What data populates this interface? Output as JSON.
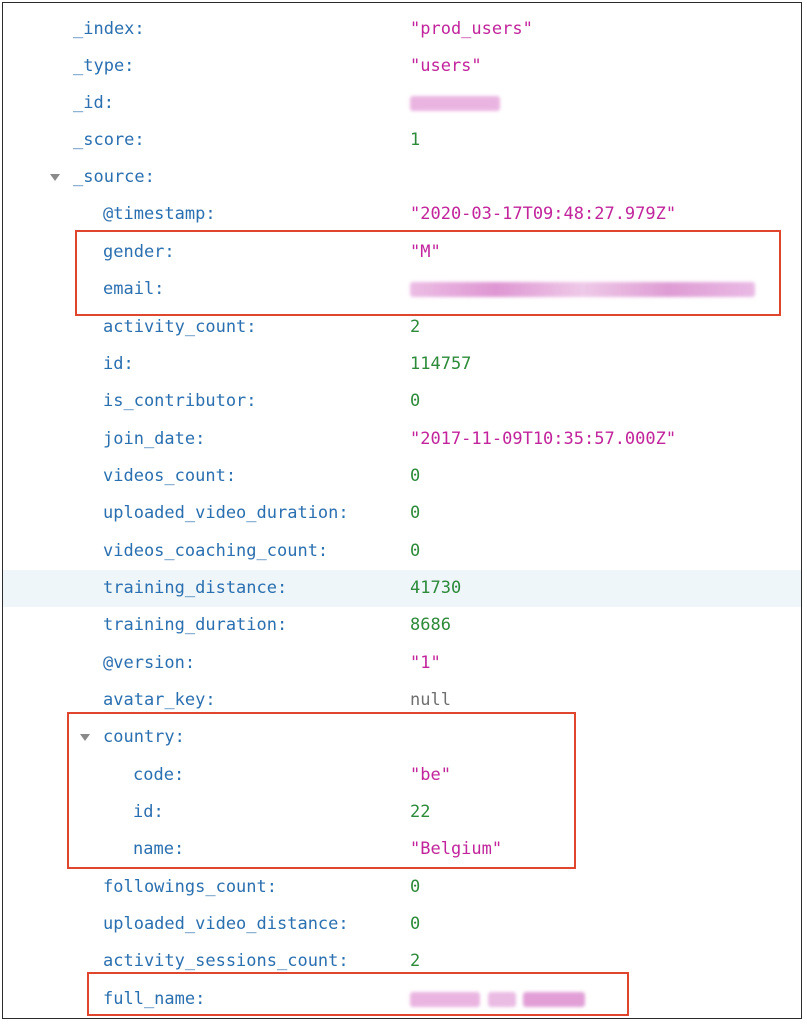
{
  "doc": {
    "index": {
      "key": "_index:",
      "value": "\"prod_users\""
    },
    "type": {
      "key": "_type:",
      "value": "\"users\""
    },
    "id": {
      "key": "_id:"
    },
    "score": {
      "key": "_score:",
      "value": "1"
    },
    "source": {
      "key": "_source:",
      "timestamp": {
        "key": "@timestamp:",
        "value": "\"2020-03-17T09:48:27.979Z\""
      },
      "gender": {
        "key": "gender:",
        "value": "\"M\""
      },
      "email": {
        "key": "email:"
      },
      "activity_count": {
        "key": "activity_count:",
        "value": "2"
      },
      "id": {
        "key": "id:",
        "value": "114757"
      },
      "is_contributor": {
        "key": "is_contributor:",
        "value": "0"
      },
      "join_date": {
        "key": "join_date:",
        "value": "\"2017-11-09T10:35:57.000Z\""
      },
      "videos_count": {
        "key": "videos_count:",
        "value": "0"
      },
      "uploaded_video_duration": {
        "key": "uploaded_video_duration:",
        "value": "0"
      },
      "videos_coaching_count": {
        "key": "videos_coaching_count:",
        "value": "0"
      },
      "training_distance": {
        "key": "training_distance:",
        "value": "41730"
      },
      "training_duration": {
        "key": "training_duration:",
        "value": "8686"
      },
      "version": {
        "key": "@version:",
        "value": "\"1\""
      },
      "avatar_key": {
        "key": "avatar_key:",
        "value": "null"
      },
      "country": {
        "key": "country:",
        "code": {
          "key": "code:",
          "value": "\"be\""
        },
        "id": {
          "key": "id:",
          "value": "22"
        },
        "name": {
          "key": "name:",
          "value": "\"Belgium\""
        }
      },
      "followings_count": {
        "key": "followings_count:",
        "value": "0"
      },
      "uploaded_video_distance": {
        "key": "uploaded_video_distance:",
        "value": "0"
      },
      "activity_sessions_count": {
        "key": "activity_sessions_count:",
        "value": "2"
      },
      "full_name": {
        "key": "full_name:"
      }
    }
  },
  "colors": {
    "key": "#2a6fb0",
    "string": "#c2249c",
    "number": "#2c8a3a",
    "null": "#6f6f6f",
    "highlight_box": "#e0452d",
    "hover_row": "#eef6fa"
  },
  "icons": {
    "expand": "triangle-down-icon"
  }
}
